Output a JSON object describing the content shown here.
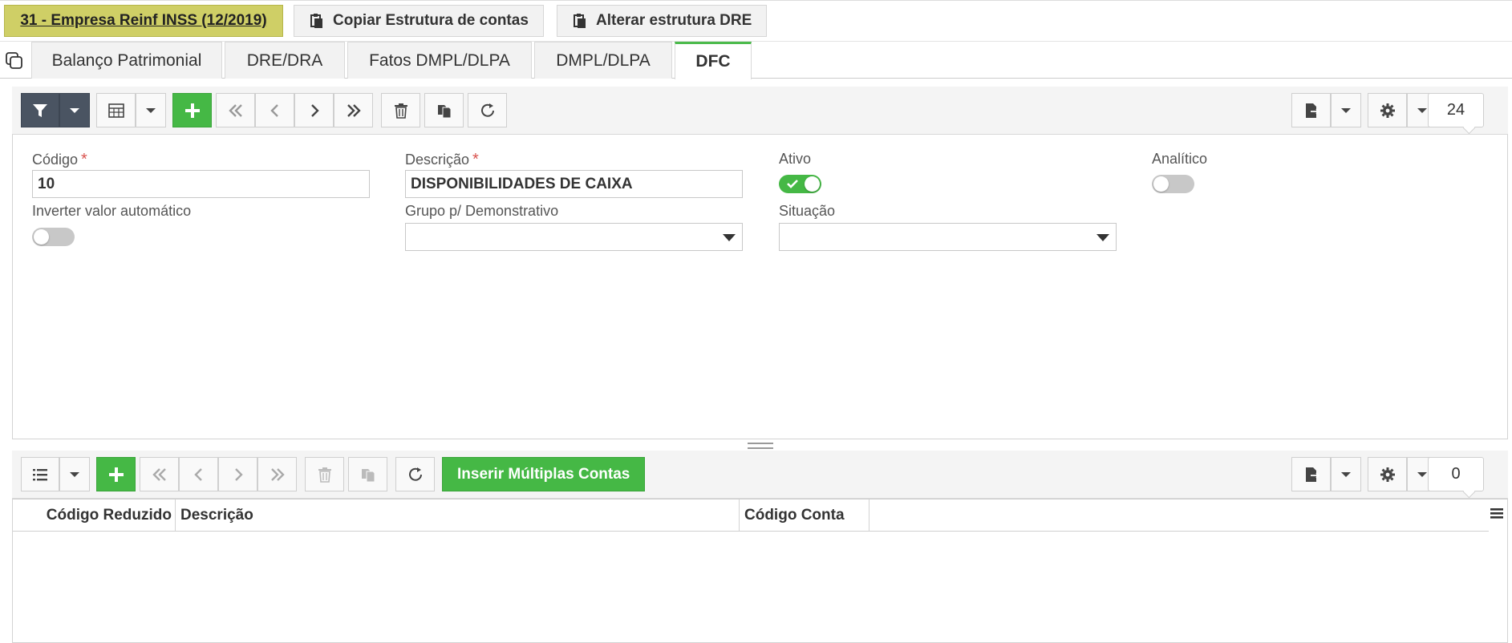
{
  "header": {
    "company": "31 - Empresa Reinf INSS (12/2019)",
    "copy_structure": "Copiar Estrutura de contas",
    "change_dre": "Alterar estrutura DRE"
  },
  "tabs": [
    {
      "label": "Balanço Patrimonial",
      "active": false
    },
    {
      "label": "DRE/DRA",
      "active": false
    },
    {
      "label": "Fatos DMPL/DLPA",
      "active": false
    },
    {
      "label": "DMPL/DLPA",
      "active": false
    },
    {
      "label": "DFC",
      "active": true
    }
  ],
  "top_toolbar": {
    "record_count": "24"
  },
  "form": {
    "codigo": {
      "label": "Código",
      "required": "*",
      "value": "10"
    },
    "descricao": {
      "label": "Descrição",
      "required": "*",
      "value": "DISPONIBILIDADES DE CAIXA"
    },
    "ativo": {
      "label": "Ativo",
      "value": true
    },
    "analitico": {
      "label": "Analítico",
      "value": false
    },
    "inverter": {
      "label": "Inverter valor automático",
      "value": false
    },
    "grupo": {
      "label": "Grupo p/ Demonstrativo",
      "value": ""
    },
    "situacao": {
      "label": "Situação",
      "value": ""
    }
  },
  "bottom_toolbar": {
    "insert_multiple": "Inserir Múltiplas Contas",
    "record_count": "0"
  },
  "grid": {
    "columns": [
      "Código Reduzido",
      "Descrição",
      "Código Conta"
    ]
  },
  "colors": {
    "accent_green": "#45b845",
    "company_yellow": "#cfcf66",
    "filter_dark": "#4a5462"
  },
  "icons": [
    "filter-icon",
    "grid-icon",
    "plus-icon",
    "first-icon",
    "prev-icon",
    "next-icon",
    "last-icon",
    "trash-icon",
    "copy-icon",
    "refresh-icon",
    "export-icon",
    "gear-icon",
    "list-icon",
    "menu-icon",
    "chevron-down-icon"
  ]
}
